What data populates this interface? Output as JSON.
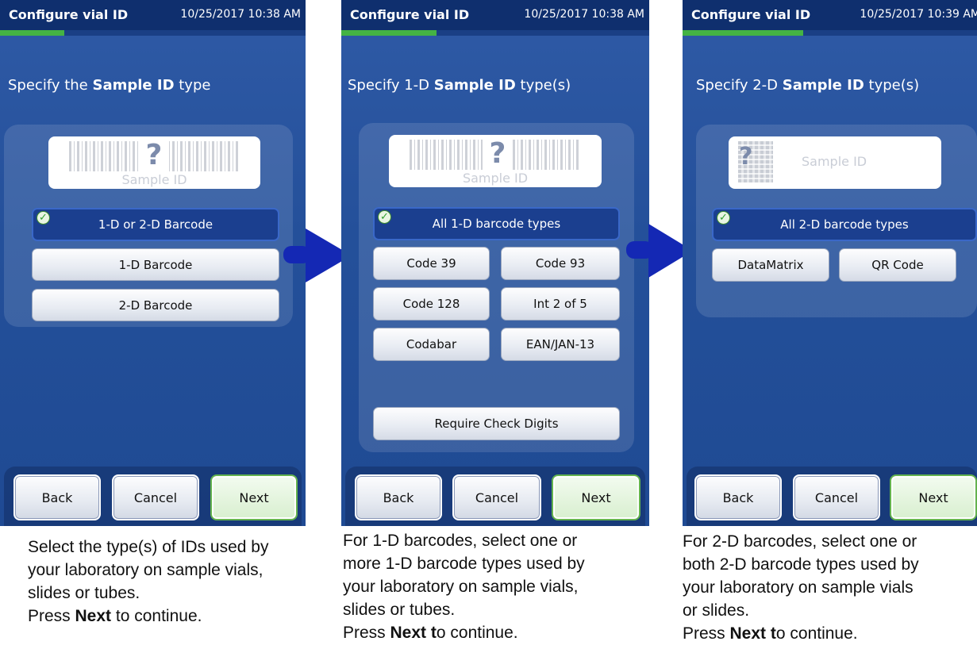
{
  "panels": [
    {
      "title": "Configure vial ID",
      "datetime": "10/25/2017 10:38 AM",
      "instruction": {
        "pre": "Specify the ",
        "bold": "Sample ID",
        "post": " type"
      },
      "sample_label": "Sample ID",
      "options": [
        "1-D or 2-D Barcode",
        "1-D Barcode",
        "2-D Barcode"
      ],
      "selected_option": "1-D or 2-D Barcode",
      "nav": {
        "back": "Back",
        "cancel": "Cancel",
        "next": "Next"
      },
      "caption": {
        "lines": [
          "Select the type(s) of IDs used by",
          "your laboratory on sample vials,",
          "slides or tubes."
        ],
        "press": "Press ",
        "press_bold": "Next",
        "press_post": " to continue."
      }
    },
    {
      "title": "Configure vial ID",
      "datetime": "10/25/2017 10:38 AM",
      "instruction": {
        "pre": "Specify 1-D ",
        "bold": "Sample ID",
        "post": " type(s)"
      },
      "sample_label": "Sample ID",
      "all_option": "All 1-D barcode types",
      "types": [
        "Code 39",
        "Code 93",
        "Code 128",
        "Int 2 of 5",
        "Codabar",
        "EAN/JAN-13"
      ],
      "check_digits": "Require Check Digits",
      "nav": {
        "back": "Back",
        "cancel": "Cancel",
        "next": "Next"
      },
      "caption": {
        "lines": [
          "For 1-D barcodes, select one or",
          "more 1-D barcode types used by",
          "your laboratory on sample vials,",
          "slides or tubes."
        ],
        "press": "Press ",
        "press_bold": "Next t",
        "press_post": "o continue."
      }
    },
    {
      "title": "Configure vial ID",
      "datetime": "10/25/2017 10:39 AM",
      "instruction": {
        "pre": "Specify 2-D ",
        "bold": "Sample ID",
        "post": " type(s)"
      },
      "sample_label": "Sample ID",
      "all_option": "All 2-D barcode types",
      "types": [
        "DataMatrix",
        "QR Code"
      ],
      "nav": {
        "back": "Back",
        "cancel": "Cancel",
        "next": "Next"
      },
      "caption": {
        "lines": [
          "For 2-D barcodes, select one or",
          "both 2-D barcode types used by",
          "your laboratory on sample vials",
          "or slides."
        ],
        "press": "Press ",
        "press_bold": "Next t",
        "press_post": "o continue."
      }
    }
  ],
  "icons": {
    "check": "check-icon",
    "arrow": "arrow-right-icon",
    "qmark": "?"
  },
  "progress": [
    0.21,
    0.31,
    0.41
  ],
  "colors": {
    "panel": "#2a56a3",
    "titlebar": "#0f2f6e",
    "progress": "#44b344",
    "arrow": "#1428b4",
    "selected": "#1b3f8f"
  }
}
